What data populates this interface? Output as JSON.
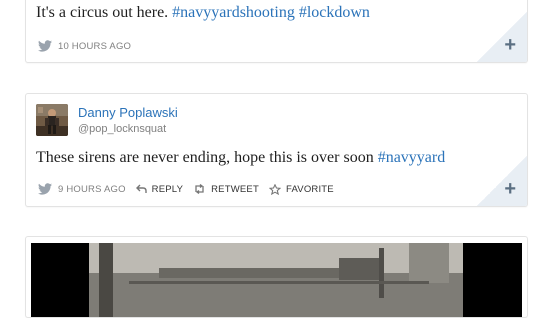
{
  "tweets": [
    {
      "text_plain": "It's a circus out here. ",
      "tags": [
        "#navyyardshooting",
        "#lockdown"
      ],
      "time": "10 HOURS AGO"
    },
    {
      "author_name": "Danny Poplawski",
      "author_handle": "@pop_locknsquat",
      "text_plain": "These sirens are never ending, hope this is over soon ",
      "tags": [
        "#navyyard"
      ],
      "time": "9 HOURS AGO",
      "actions": {
        "reply": "REPLY",
        "retweet": "RETWEET",
        "favorite": "FAVORITE"
      }
    }
  ],
  "colors": {
    "link": "#2b73b9",
    "text": "#1f1f1f",
    "meta": "#808080",
    "border": "#e3e3e3"
  },
  "icons": [
    "twitter-bird-icon",
    "reply-icon",
    "retweet-icon",
    "favorite-star-icon",
    "plus-icon"
  ]
}
